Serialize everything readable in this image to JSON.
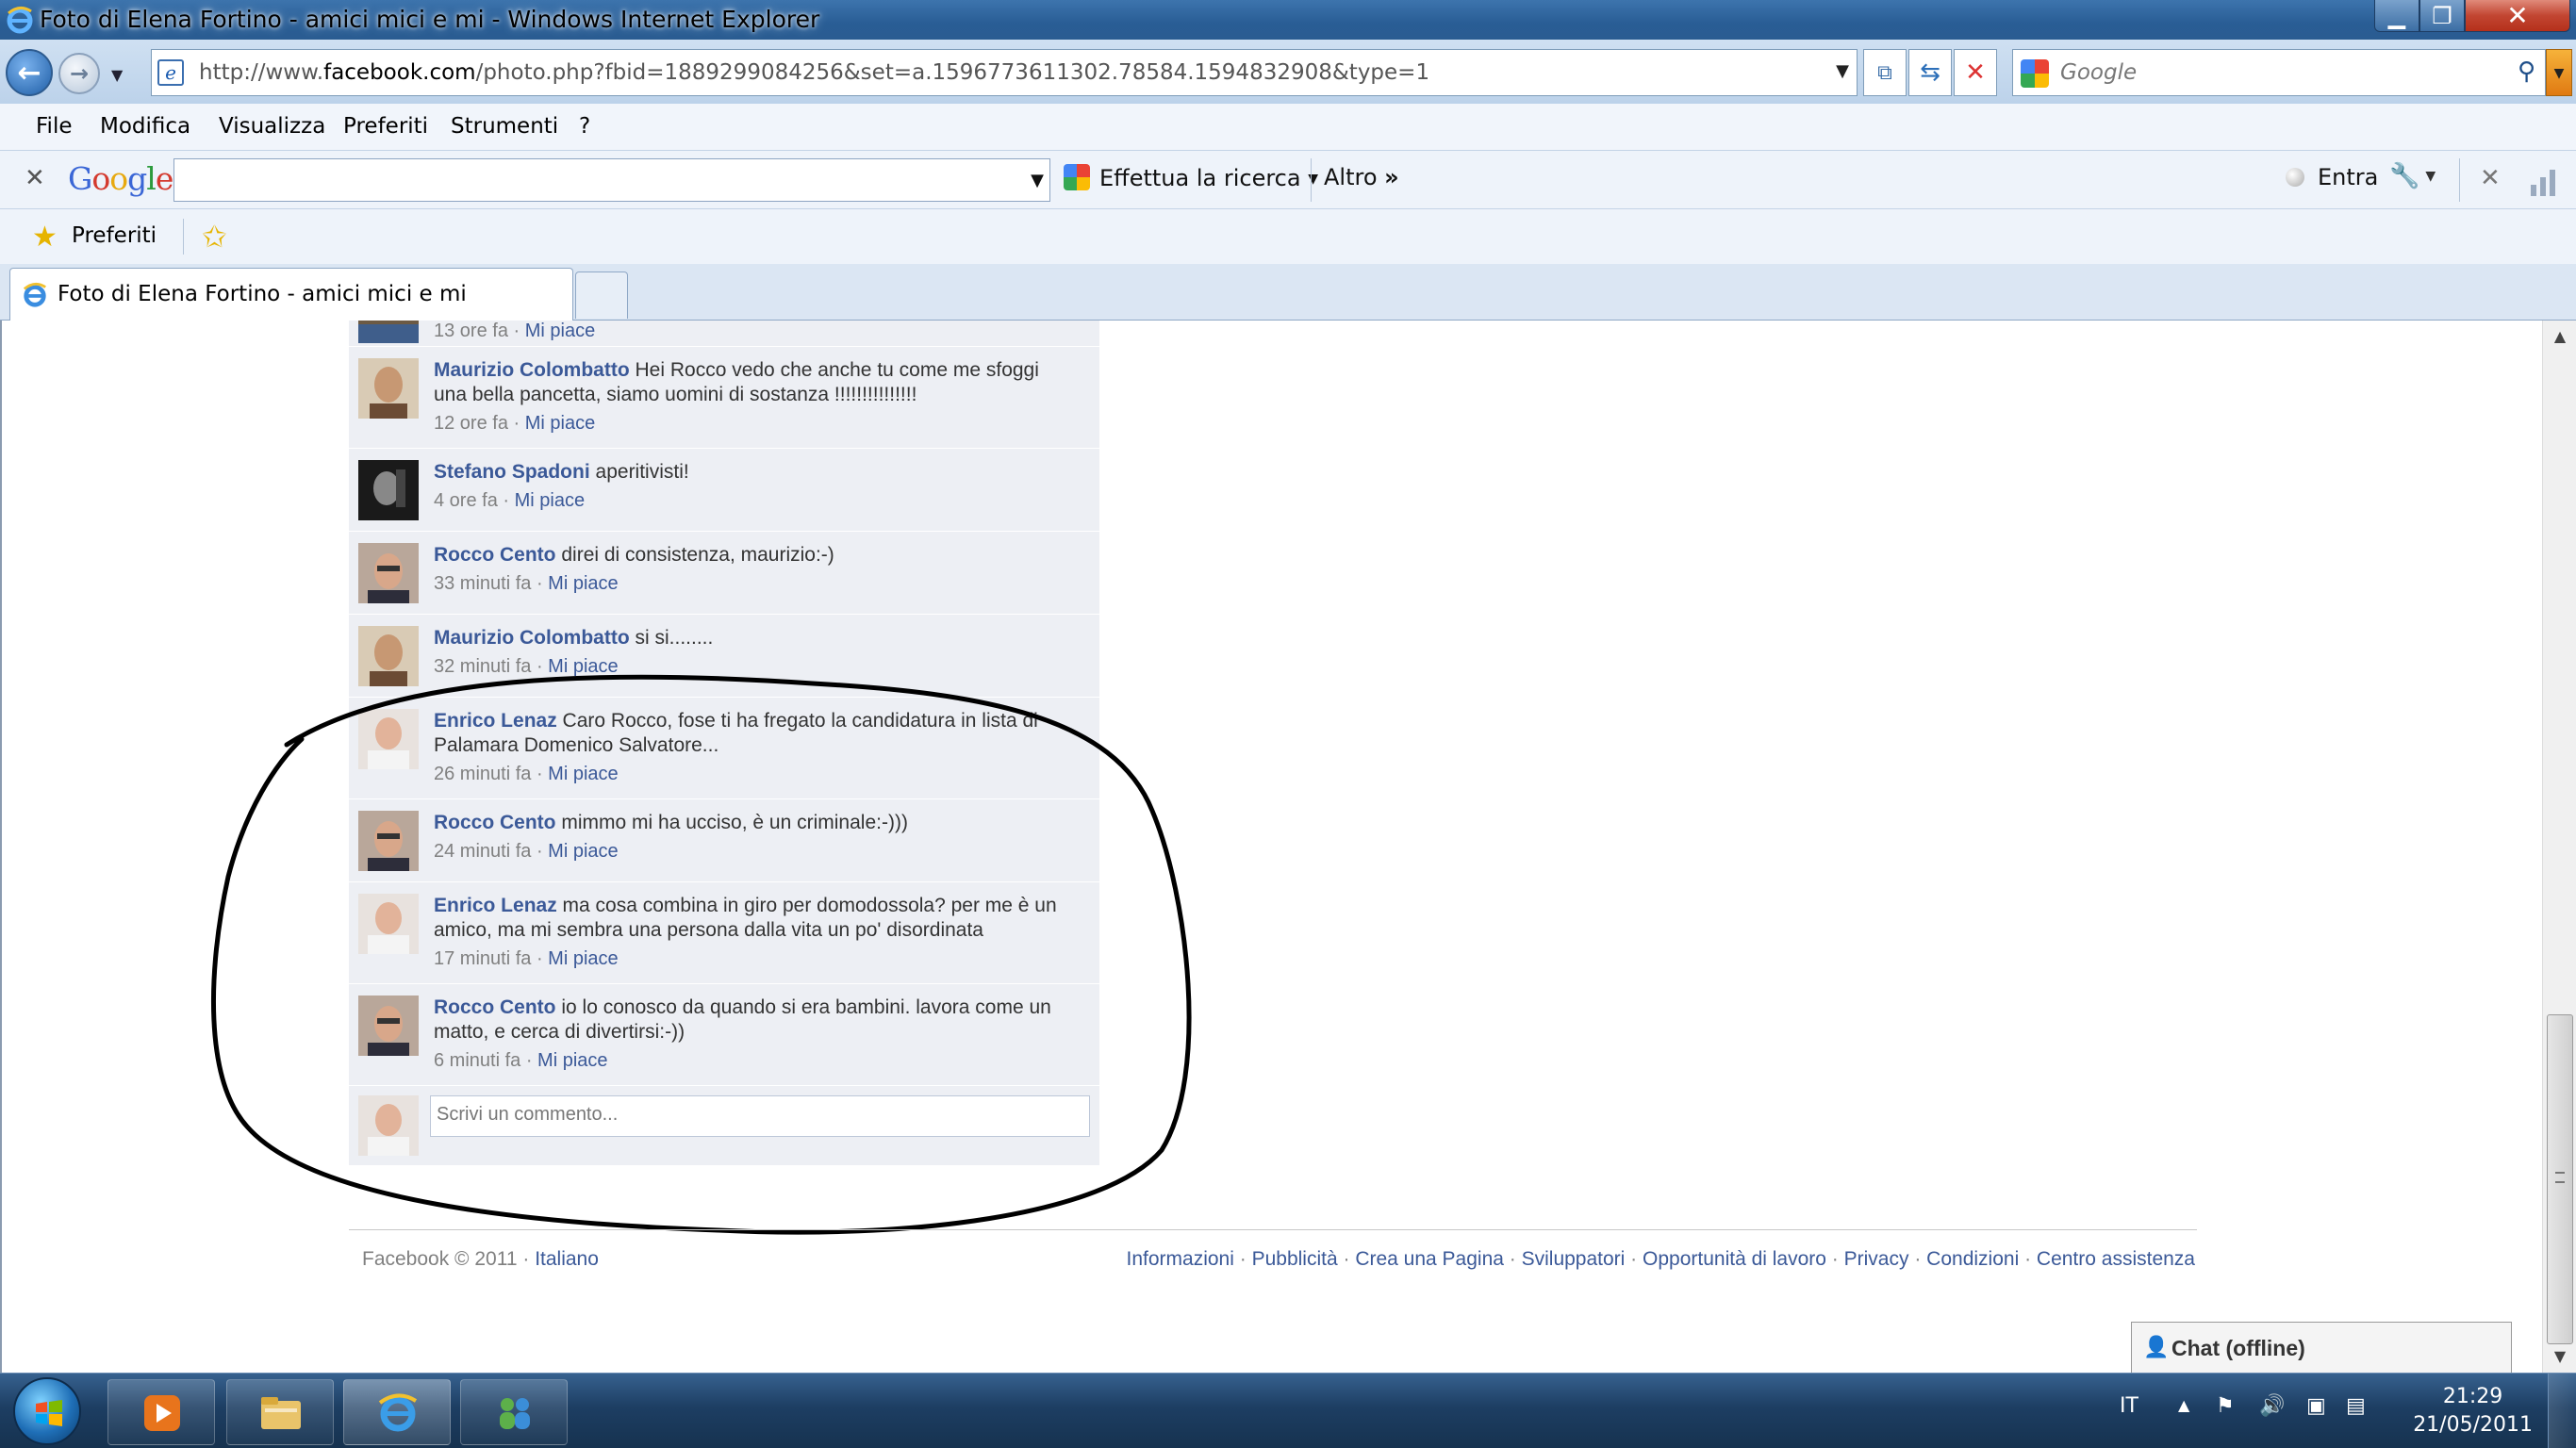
{
  "window": {
    "title": "Foto di Elena Fortino - amici mici e mi - Windows Internet Explorer"
  },
  "address_bar": {
    "url_prefix": "http://www.",
    "url_domain": "facebook.com",
    "url_rest": "/photo.php?fbid=1889299084256&set=a.1596773611302.78584.1594832908&type=1"
  },
  "search_box": {
    "placeholder": "Google"
  },
  "menu": {
    "items": [
      "File",
      "Modifica",
      "Visualizza",
      "Preferiti",
      "Strumenti",
      "?"
    ]
  },
  "google_toolbar": {
    "logo": "Google",
    "search_button": "Effettua la ricerca",
    "more": "Altro",
    "sign_in": "Entra"
  },
  "favorites_bar": {
    "label": "Preferiti"
  },
  "tab": {
    "title": "Foto di Elena Fortino - amici mici e mi"
  },
  "comments": [
    {
      "author": "",
      "text": "",
      "time": "13 ore fa",
      "like": "Mi piace"
    },
    {
      "author": "Maurizio Colombatto",
      "text": "Hei Rocco vedo che anche tu come me sfoggi una bella pancetta, siamo uomini di sostanza !!!!!!!!!!!!!!!",
      "time": "12 ore fa",
      "like": "Mi piace"
    },
    {
      "author": "Stefano Spadoni",
      "text": "aperitivisti!",
      "time": "4 ore fa",
      "like": "Mi piace"
    },
    {
      "author": "Rocco Cento",
      "text": "direi di consistenza, maurizio:-)",
      "time": "33 minuti fa",
      "like": "Mi piace"
    },
    {
      "author": "Maurizio Colombatto",
      "text": "si si........",
      "time": "32 minuti fa",
      "like": "Mi piace"
    },
    {
      "author": "Enrico Lenaz",
      "text": "Caro Rocco, fose ti ha fregato la candidatura in lista di Palamara Domenico Salvatore...",
      "time": "26 minuti fa",
      "like": "Mi piace"
    },
    {
      "author": "Rocco Cento",
      "text": "mimmo mi ha ucciso, è un criminale:-)))",
      "time": "24 minuti fa",
      "like": "Mi piace"
    },
    {
      "author": "Enrico Lenaz",
      "text": "ma cosa combina in giro per domodossola? per me è un amico, ma mi sembra una persona dalla vita un po' disordinata",
      "time": "17 minuti fa",
      "like": "Mi piace"
    },
    {
      "author": "Rocco Cento",
      "text": "io lo conosco da quando si era bambini. lavora come un matto, e cerca di divertirsi:-))",
      "time": "6 minuti fa",
      "like": "Mi piace"
    }
  ],
  "comment_input": {
    "placeholder": "Scrivi un commento..."
  },
  "footer": {
    "copyright": "Facebook © 2011",
    "language": "Italiano",
    "links": [
      "Informazioni",
      "Pubblicità",
      "Crea una Pagina",
      "Sviluppatori",
      "Opportunità di lavoro",
      "Privacy",
      "Condizioni",
      "Centro assistenza"
    ]
  },
  "chat": {
    "label": "Chat (offline)"
  },
  "taskbar": {
    "language": "IT",
    "time": "21:29",
    "date": "21/05/2011"
  },
  "icons": [
    "ie-logo-icon",
    "back-arrow-icon",
    "forward-arrow-icon",
    "compatibility-icon",
    "refresh-icon",
    "stop-icon",
    "search-magnifier-icon",
    "close-toolbar-icon",
    "google-icon",
    "wrench-icon",
    "signal-bars-icon",
    "favorites-star-icon",
    "add-favorites-icon",
    "chat-user-icon",
    "windows-start-icon",
    "media-player-icon",
    "explorer-folder-icon",
    "messenger-icon",
    "tray-up-arrow-icon",
    "flag-icon",
    "volume-icon",
    "network-icon"
  ],
  "colors": {
    "facebook_link": "#3b5998",
    "comment_bg": "#edeff4",
    "title_bar": "#2a5c91"
  }
}
